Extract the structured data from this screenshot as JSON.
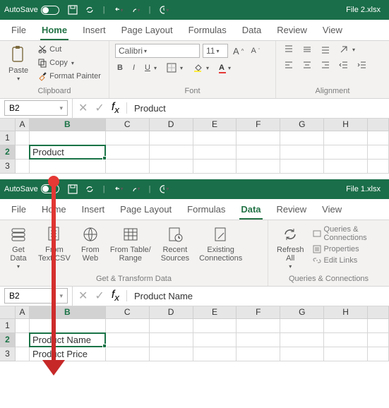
{
  "win1": {
    "autosave": "AutoSave",
    "filename": "File 2.xlsx",
    "tabs": [
      "File",
      "Home",
      "Insert",
      "Page Layout",
      "Formulas",
      "Data",
      "Review",
      "View"
    ],
    "active_tab": "Home",
    "clipboard": {
      "paste": "Paste",
      "cut": "Cut",
      "copy": "Copy",
      "fp": "Format Painter",
      "label": "Clipboard"
    },
    "font": {
      "name": "Calibri",
      "size": "11",
      "label": "Font"
    },
    "alignment": {
      "label": "Alignment"
    },
    "namebox": "B2",
    "formula": "Product",
    "cols": [
      "A",
      "B",
      "C",
      "D",
      "E",
      "F",
      "G",
      "H"
    ],
    "rows": [
      "1",
      "2",
      "3"
    ],
    "cells": {
      "B2": "Product"
    }
  },
  "win2": {
    "autosave": "AutoSave",
    "filename": "File 1.xlsx",
    "tabs": [
      "File",
      "Home",
      "Insert",
      "Page Layout",
      "Formulas",
      "Data",
      "Review",
      "View"
    ],
    "active_tab": "Data",
    "gtd": {
      "get": "Get\nData",
      "csv": "From\nText/CSV",
      "web": "From\nWeb",
      "tbl": "From Table/\nRange",
      "rec": "Recent\nSources",
      "ex": "Existing\nConnections",
      "label": "Get & Transform Data"
    },
    "qc": {
      "refresh": "Refresh\nAll",
      "q": "Queries & Connections",
      "p": "Properties",
      "e": "Edit Links",
      "label": "Queries & Connections"
    },
    "namebox": "B2",
    "formula": "Product Name",
    "cols": [
      "A",
      "B",
      "C",
      "D",
      "E",
      "F",
      "G",
      "H"
    ],
    "rows": [
      "1",
      "2",
      "3"
    ],
    "cells": {
      "B2": "Product Name",
      "B3": "Product Price"
    }
  }
}
